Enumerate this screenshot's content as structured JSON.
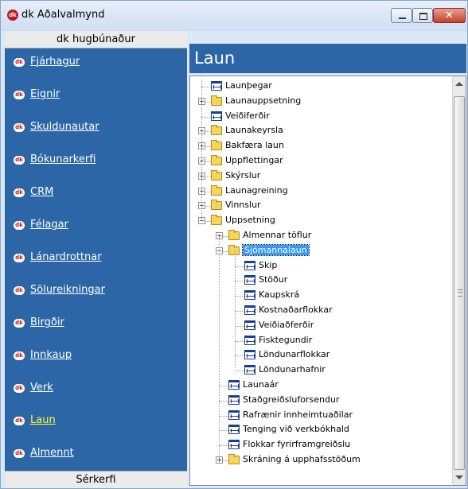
{
  "window": {
    "title": "dk Aðalvalmynd"
  },
  "left": {
    "header": "dk hugbúnaður",
    "footer": "Sérkerfi",
    "items": [
      {
        "label": "Fjárhagur"
      },
      {
        "label": "Eignir"
      },
      {
        "label": "Skuldunautar"
      },
      {
        "label": "Bókunarkerfi"
      },
      {
        "label": "CRM"
      },
      {
        "label": "Félagar"
      },
      {
        "label": "Lánardrottnar"
      },
      {
        "label": "Sölureikningar"
      },
      {
        "label": "Birgðir"
      },
      {
        "label": "Innkaup"
      },
      {
        "label": "Verk"
      },
      {
        "label": "Laun",
        "active": true
      },
      {
        "label": "Almennt"
      }
    ]
  },
  "main": {
    "heading": "Laun",
    "tree": [
      {
        "label": "Launþegar",
        "type": "table",
        "level": 0
      },
      {
        "label": "Launauppsetning",
        "type": "folder",
        "level": 0,
        "expander": "+"
      },
      {
        "label": "Veiðiferðir",
        "type": "table",
        "level": 0
      },
      {
        "label": "Launakeyrsla",
        "type": "folder",
        "level": 0,
        "expander": "+"
      },
      {
        "label": "Bakfæra laun",
        "type": "folder",
        "level": 0,
        "expander": "+"
      },
      {
        "label": "Uppflettingar",
        "type": "folder",
        "level": 0,
        "expander": "+"
      },
      {
        "label": "Skýrslur",
        "type": "folder",
        "level": 0,
        "expander": "+"
      },
      {
        "label": "Launagreining",
        "type": "folder",
        "level": 0,
        "expander": "+"
      },
      {
        "label": "Vinnslur",
        "type": "folder",
        "level": 0,
        "expander": "+"
      },
      {
        "label": "Uppsetning",
        "type": "folder",
        "level": 0,
        "expander": "−"
      },
      {
        "label": "Almennar töflur",
        "type": "folder",
        "level": 1,
        "expander": "+"
      },
      {
        "label": "Sjómannalaun",
        "type": "folder",
        "level": 1,
        "expander": "−",
        "selected": true
      },
      {
        "label": "Skip",
        "type": "table",
        "level": 2
      },
      {
        "label": "Stöður",
        "type": "table",
        "level": 2
      },
      {
        "label": "Kaupskrá",
        "type": "table",
        "level": 2
      },
      {
        "label": "Kostnaðarflokkar",
        "type": "table",
        "level": 2
      },
      {
        "label": "Veiðiaðferðir",
        "type": "table",
        "level": 2
      },
      {
        "label": "Fisktegundir",
        "type": "table",
        "level": 2
      },
      {
        "label": "Löndunarflokkar",
        "type": "table",
        "level": 2
      },
      {
        "label": "Löndunarhafnir",
        "type": "table",
        "level": 2
      },
      {
        "label": "Launaár",
        "type": "table",
        "level": 1
      },
      {
        "label": "Staðgreiðsluforsendur",
        "type": "table",
        "level": 1
      },
      {
        "label": "Rafrænir innheimtuaðilar",
        "type": "table",
        "level": 1
      },
      {
        "label": "Tenging við verkbókhald",
        "type": "table",
        "level": 1
      },
      {
        "label": "Flokkar fyrirframgreiðslu",
        "type": "table",
        "level": 1
      },
      {
        "label": "Skráning á upphafsstöðum",
        "type": "folder",
        "level": 1,
        "expander": "+"
      }
    ]
  },
  "icons": {
    "app": "dk-logo-icon",
    "nav": "dk-logo-icon",
    "table": "table-icon",
    "folder": "folder-icon"
  },
  "colors": {
    "panel": "#2d66a7",
    "active_nav": "#ffff32",
    "selection": "#3399ff"
  }
}
